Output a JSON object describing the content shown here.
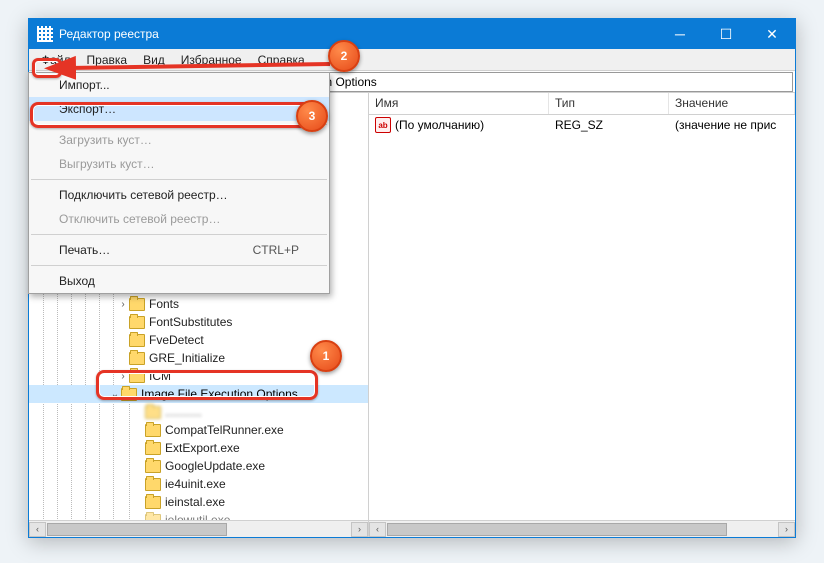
{
  "window": {
    "title": "Редактор реестра"
  },
  "menubar": {
    "items": [
      "Файл",
      "Правка",
      "Вид",
      "Избранное",
      "Справка"
    ]
  },
  "addressbar": {
    "value": "osoft\\Windows NT\\CurrentVersion\\Image File Execution Options"
  },
  "dropdown": {
    "items": [
      {
        "label": "Импорт...",
        "enabled": true
      },
      {
        "label": "Экспорт…",
        "enabled": true,
        "highlight": true
      },
      {
        "sep": true
      },
      {
        "label": "Загрузить куст…",
        "enabled": false
      },
      {
        "label": "Выгрузить куст…",
        "enabled": false
      },
      {
        "sep": true
      },
      {
        "label": "Подключить сетевой реестр…",
        "enabled": true
      },
      {
        "label": "Отключить сетевой реестр…",
        "enabled": false
      },
      {
        "sep": true
      },
      {
        "label": "Печать…",
        "enabled": true,
        "shortcut": "CTRL+P"
      },
      {
        "sep": true
      },
      {
        "label": "Выход",
        "enabled": true
      }
    ]
  },
  "tree": {
    "items": [
      {
        "indent": 88,
        "label": "Fonts"
      },
      {
        "indent": 88,
        "label": "FontSubstitutes"
      },
      {
        "indent": 88,
        "label": "FveDetect"
      },
      {
        "indent": 88,
        "label": "GRE_Initialize"
      },
      {
        "indent": 88,
        "label": "ICM"
      },
      {
        "indent": 88,
        "label": "Image File Execution Options",
        "expanded": true,
        "selected": true
      },
      {
        "indent": 104,
        "label": "",
        "blurred": true
      },
      {
        "indent": 104,
        "label": "CompatTelRunner.exe"
      },
      {
        "indent": 104,
        "label": "ExtExport.exe"
      },
      {
        "indent": 104,
        "label": "GoogleUpdate.exe"
      },
      {
        "indent": 104,
        "label": "ie4uinit.exe"
      },
      {
        "indent": 104,
        "label": "ieinstal.exe"
      },
      {
        "indent": 104,
        "label": "ielowutil.exe"
      }
    ]
  },
  "listheader": {
    "cols": [
      "Имя",
      "Тип",
      "Значение"
    ]
  },
  "listrows": [
    {
      "icon": "ab",
      "name": "(По умолчанию)",
      "type": "REG_SZ",
      "value": "(значение не прис"
    }
  ],
  "callouts": {
    "c1": "1",
    "c2": "2",
    "c3": "3"
  }
}
